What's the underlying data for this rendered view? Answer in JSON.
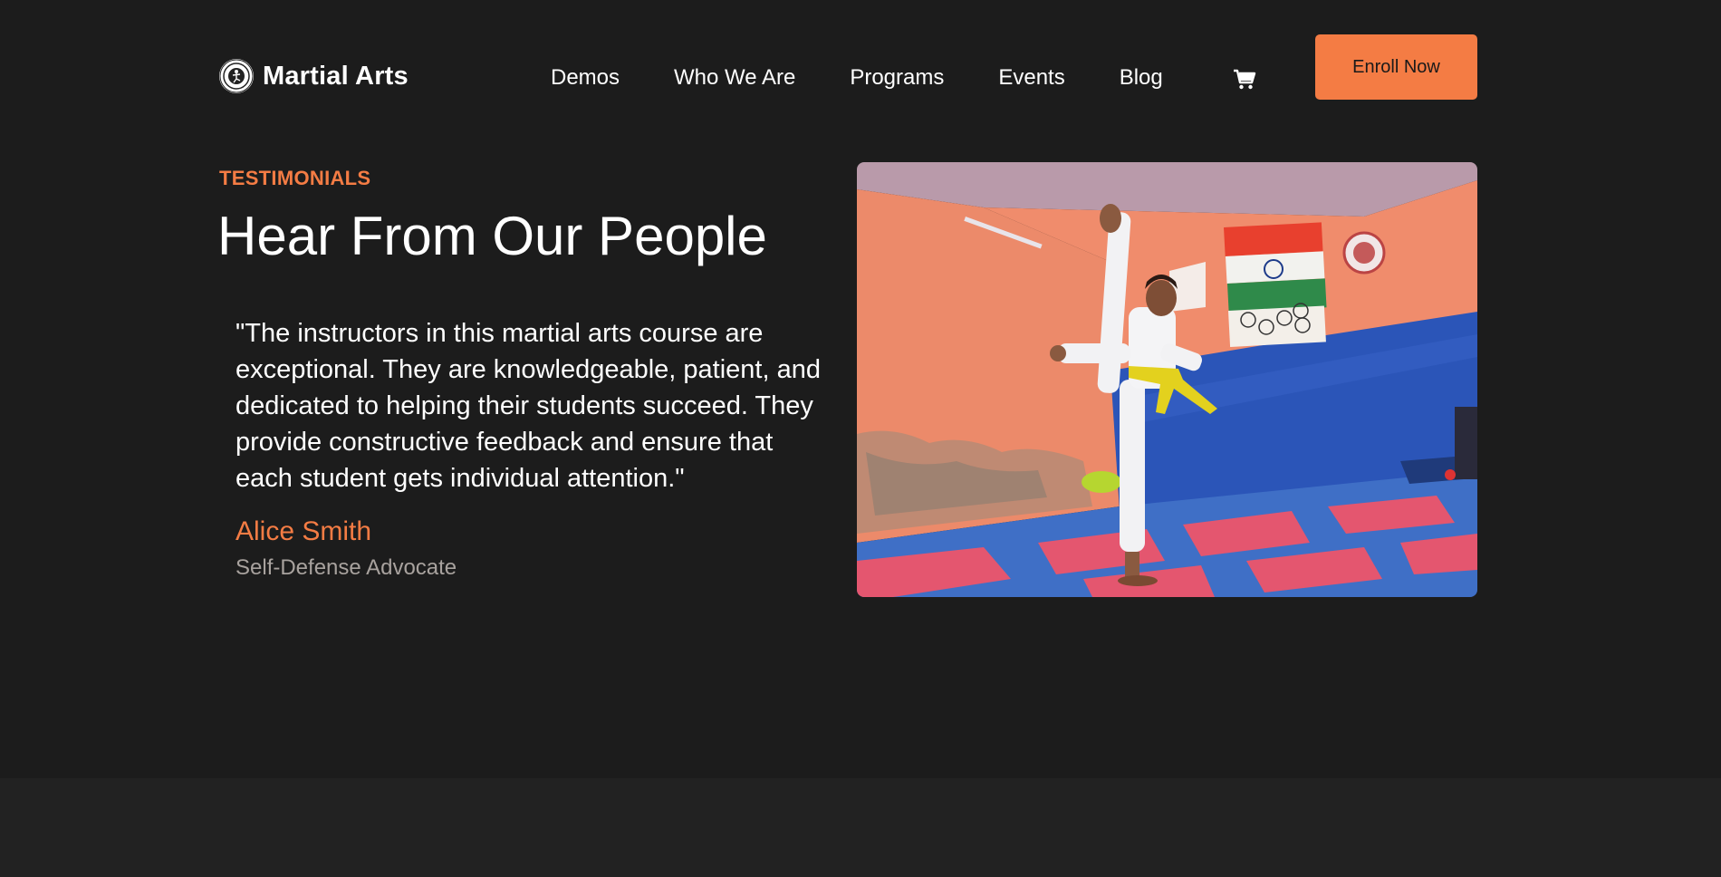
{
  "header": {
    "brand_name": "Martial Arts",
    "logo_icon": "martial-arts-logo-icon",
    "nav": [
      {
        "label": "Demos"
      },
      {
        "label": "Who We Are"
      },
      {
        "label": "Programs"
      },
      {
        "label": "Events"
      },
      {
        "label": "Blog"
      }
    ],
    "cart_icon": "shopping-cart-icon",
    "enroll_label": "Enroll Now"
  },
  "testimonial": {
    "eyebrow": "TESTIMONIALS",
    "title": "Hear From Our People",
    "quote": "\"The instructors in this martial arts course are exceptional. They are knowledgeable, patient, and dedicated to helping their students succeed. They provide constructive feedback and ensure that each student gets individual attention.\"",
    "author": "Alice Smith",
    "role": "Self-Defense Advocate"
  },
  "photo": {
    "flag_letters": [
      "I",
      "N",
      "D",
      "I",
      "A"
    ]
  },
  "colors": {
    "background": "#1c1c1c",
    "footer_band": "#222222",
    "accent": "#f47c44",
    "text": "#ffffff",
    "muted": "#a8a29e"
  }
}
